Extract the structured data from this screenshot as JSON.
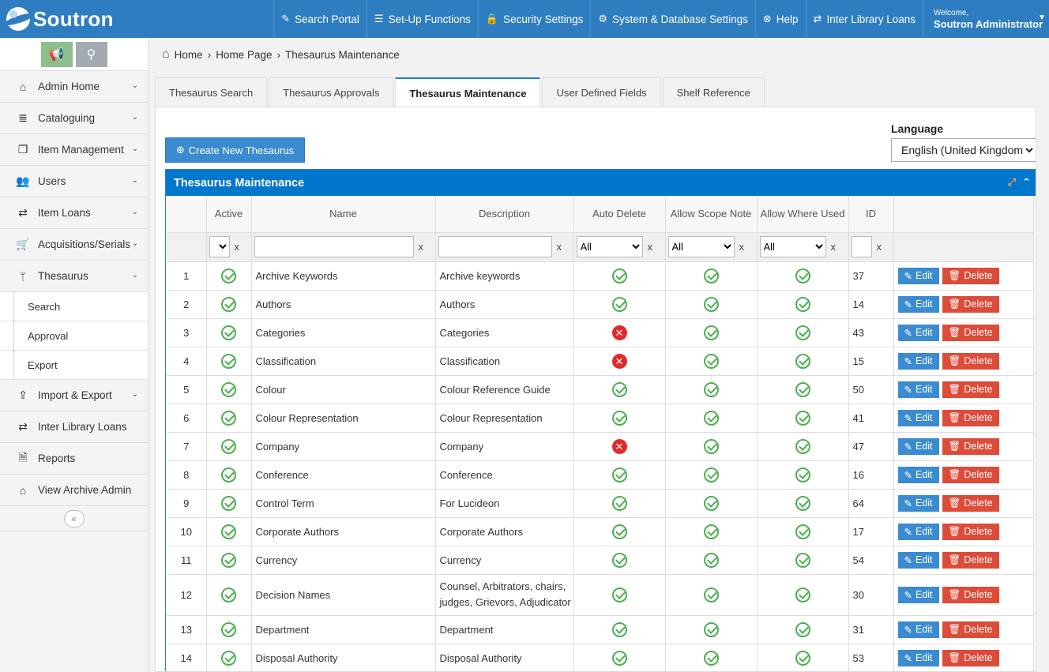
{
  "brand": {
    "name": "Soutron"
  },
  "topnav": {
    "items": [
      {
        "icon": "edit-icon",
        "glyph": "✎",
        "label": "Search Portal"
      },
      {
        "icon": "settings-bars-icon",
        "glyph": "☰",
        "label": "Set-Up Functions"
      },
      {
        "icon": "lock-icon",
        "glyph": "🔒",
        "label": "Security Settings"
      },
      {
        "icon": "gear-icon",
        "glyph": "⚙",
        "label": "System & Database Settings"
      },
      {
        "icon": "help-icon",
        "glyph": "⊗",
        "label": "Help"
      },
      {
        "icon": "exchange-icon",
        "glyph": "⇄",
        "label": "Inter Library Loans"
      }
    ],
    "welcome_label": "Welcome,",
    "user_name": "Soutron Administrator"
  },
  "sidebar": {
    "items": [
      {
        "name": "admin-home",
        "icon": "home-icon",
        "glyph": "⌂",
        "label": "Admin Home",
        "chevron": true
      },
      {
        "name": "cataloguing",
        "icon": "database-icon",
        "glyph": "≣",
        "label": "Cataloguing",
        "chevron": true
      },
      {
        "name": "item-management",
        "icon": "copy-icon",
        "glyph": "❐",
        "label": "Item Management",
        "chevron": true
      },
      {
        "name": "users",
        "icon": "users-icon",
        "glyph": "👥",
        "label": "Users",
        "chevron": true
      },
      {
        "name": "item-loans",
        "icon": "exchange-icon",
        "glyph": "⇄",
        "label": "Item Loans",
        "chevron": true
      },
      {
        "name": "acquisitions-serials",
        "icon": "cart-icon",
        "glyph": "🛒",
        "label": "Acquisitions/Serials",
        "chevron": true
      },
      {
        "name": "thesaurus",
        "icon": "branch-icon",
        "glyph": "ᛘ",
        "label": "Thesaurus",
        "chevron": true
      }
    ],
    "sub_items": [
      "Search",
      "Approval",
      "Export"
    ],
    "items_after": [
      {
        "name": "import-export",
        "icon": "upload-icon",
        "glyph": "⇪",
        "label": "Import & Export",
        "chevron": true
      },
      {
        "name": "inter-library-loans",
        "icon": "exchange-icon",
        "glyph": "⇄",
        "label": "Inter Library Loans",
        "chevron": false
      },
      {
        "name": "reports",
        "icon": "document-icon",
        "glyph": "🗎",
        "label": "Reports",
        "chevron": false
      },
      {
        "name": "view-archive-admin",
        "icon": "home-icon",
        "glyph": "⌂",
        "label": "View Archive Admin",
        "chevron": false
      }
    ]
  },
  "breadcrumb": {
    "home": "Home",
    "page": "Home Page",
    "current": "Thesaurus Maintenance"
  },
  "tabs": [
    "Thesaurus Search",
    "Thesaurus Approvals",
    "Thesaurus Maintenance",
    "User Defined Fields",
    "Shelf Reference"
  ],
  "active_tab": 2,
  "create_button": "Create New Thesaurus",
  "language": {
    "label": "Language",
    "selected": "English (United Kingdom)"
  },
  "grid": {
    "title": "Thesaurus Maintenance",
    "columns": [
      "Active",
      "Name",
      "Description",
      "Auto Delete",
      "Allow Scope Note",
      "Allow Where Used",
      "ID"
    ],
    "filter_all": "All",
    "clear_label": "x",
    "edit_label": "Edit",
    "delete_label": "Delete",
    "rows": [
      {
        "n": "1",
        "active": true,
        "name": "Archive Keywords",
        "desc": "Archive keywords",
        "auto": true,
        "scope": true,
        "where": true,
        "id": "37"
      },
      {
        "n": "2",
        "active": true,
        "name": "Authors",
        "desc": "Authors",
        "auto": true,
        "scope": true,
        "where": true,
        "id": "14"
      },
      {
        "n": "3",
        "active": true,
        "name": "Categories",
        "desc": "Categories",
        "auto": false,
        "scope": true,
        "where": true,
        "id": "43"
      },
      {
        "n": "4",
        "active": true,
        "name": "Classification",
        "desc": "Classification",
        "auto": false,
        "scope": true,
        "where": true,
        "id": "15"
      },
      {
        "n": "5",
        "active": true,
        "name": "Colour",
        "desc": "Colour Reference Guide",
        "auto": true,
        "scope": true,
        "where": true,
        "id": "50"
      },
      {
        "n": "6",
        "active": true,
        "name": "Colour Representation",
        "desc": "Colour Representation",
        "auto": true,
        "scope": true,
        "where": true,
        "id": "41"
      },
      {
        "n": "7",
        "active": true,
        "name": "Company",
        "desc": "Company",
        "auto": false,
        "scope": true,
        "where": true,
        "id": "47"
      },
      {
        "n": "8",
        "active": true,
        "name": "Conference",
        "desc": "Conference",
        "auto": true,
        "scope": true,
        "where": true,
        "id": "16"
      },
      {
        "n": "9",
        "active": true,
        "name": "Control Term",
        "desc": "For Lucideon",
        "auto": true,
        "scope": true,
        "where": true,
        "id": "64"
      },
      {
        "n": "10",
        "active": true,
        "name": "Corporate Authors",
        "desc": "Corporate Authors",
        "auto": true,
        "scope": true,
        "where": true,
        "id": "17"
      },
      {
        "n": "11",
        "active": true,
        "name": "Currency",
        "desc": "Currency",
        "auto": true,
        "scope": true,
        "where": true,
        "id": "54"
      },
      {
        "n": "12",
        "active": true,
        "name": "Decision Names",
        "desc": "Counsel, Arbitrators, chairs, judges, Grievors, Adjudicator",
        "auto": true,
        "scope": true,
        "where": true,
        "id": "30",
        "tall": true
      },
      {
        "n": "13",
        "active": true,
        "name": "Department",
        "desc": "Department",
        "auto": true,
        "scope": true,
        "where": true,
        "id": "31"
      },
      {
        "n": "14",
        "active": true,
        "name": "Disposal Authority",
        "desc": "Disposal Authority",
        "auto": true,
        "scope": true,
        "where": true,
        "id": "53"
      }
    ]
  },
  "colors": {
    "primary": "#2e7dc1",
    "grid_header": "#0077cc",
    "ok": "#4caf50",
    "no": "#e02a2a",
    "delete": "#dd4b39"
  }
}
